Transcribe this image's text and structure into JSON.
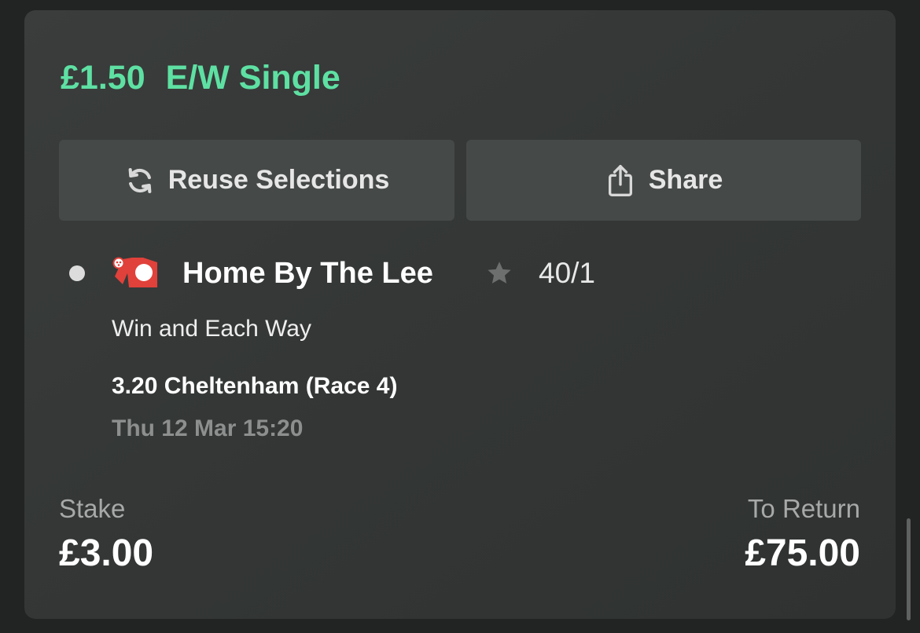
{
  "bet": {
    "stake_amount": "£1.50",
    "bet_type": "E/W Single"
  },
  "actions": {
    "reuse_label": "Reuse Selections",
    "reuse_icon": "refresh-icon",
    "share_label": "Share",
    "share_icon": "share-icon"
  },
  "selection": {
    "horse_name": "Home By The Lee",
    "odds": "40/1",
    "market": "Win and Each Way",
    "race": "3.20 Cheltenham (Race 4)",
    "race_time": "Thu 12 Mar 15:20",
    "silks_icon": "jockey-silks-icon",
    "favourite_icon": "star-icon"
  },
  "totals": {
    "stake_label": "Stake",
    "stake_value": "£3.00",
    "return_label": "To Return",
    "return_value": "£75.00"
  },
  "colors": {
    "accent_green": "#5ee0a3",
    "card_background": "#363938",
    "button_background": "#454948",
    "page_background": "#222323"
  }
}
